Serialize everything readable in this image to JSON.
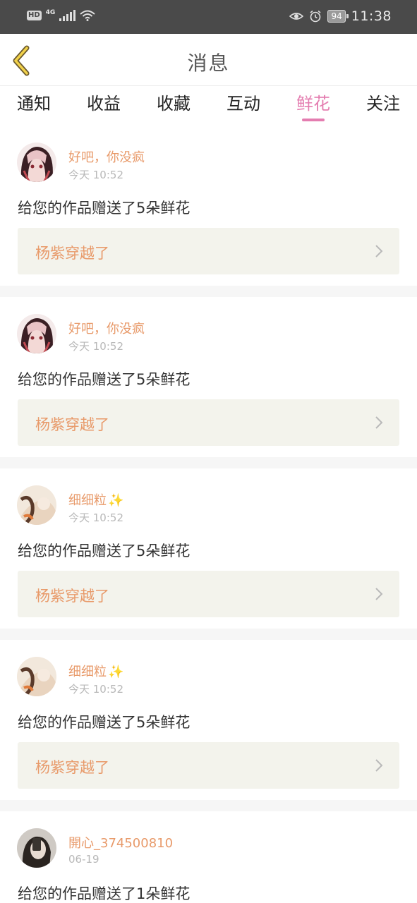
{
  "status_bar": {
    "hd": "HD",
    "network": "4G",
    "battery": "94",
    "time": "11:38"
  },
  "header": {
    "title": "消息"
  },
  "tabs": [
    {
      "label": "通知"
    },
    {
      "label": "收益"
    },
    {
      "label": "收藏"
    },
    {
      "label": "互动"
    },
    {
      "label": "鲜花",
      "active": true
    },
    {
      "label": "关注"
    }
  ],
  "messages": [
    {
      "user": "好吧，你没疯",
      "time": "今天 10:52",
      "text": "给您的作品赠送了5朵鲜花",
      "work": "杨紫穿越了"
    },
    {
      "user": "好吧，你没疯",
      "time": "今天 10:52",
      "text": "给您的作品赠送了5朵鲜花",
      "work": "杨紫穿越了"
    },
    {
      "user": "细细粒",
      "sparkle": "✨",
      "time": "今天 10:52",
      "text": "给您的作品赠送了5朵鲜花",
      "work": "杨紫穿越了"
    },
    {
      "user": "细细粒",
      "sparkle": "✨",
      "time": "今天 10:52",
      "text": "给您的作品赠送了5朵鲜花",
      "work": "杨紫穿越了"
    },
    {
      "user": "開心_374500810",
      "time": "06-19",
      "text": "给您的作品赠送了1朵鲜花"
    }
  ],
  "colors": {
    "accent": "#e47db0",
    "username": "#e89a6a",
    "work_box_bg": "#f3f3ec",
    "status_bar_bg": "#4a4a4a"
  },
  "icons": {
    "back": "chevron-left-icon",
    "row_arrow": "chevron-right-icon",
    "eye": "eye-icon",
    "alarm": "alarm-icon",
    "wifi": "wifi-icon",
    "signal": "signal-icon",
    "battery": "battery-icon"
  }
}
